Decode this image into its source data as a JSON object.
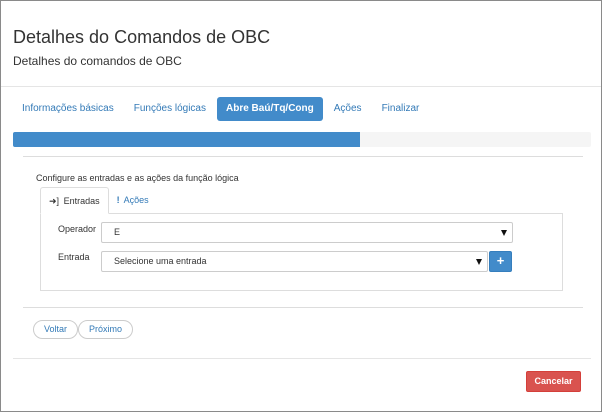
{
  "header": {
    "title": "Detalhes do Comandos de OBC",
    "subtitle": "Detalhes do comandos de OBC"
  },
  "wizard": {
    "steps": [
      {
        "label": "Informações básicas",
        "active": false
      },
      {
        "label": "Funções lógicas",
        "active": false
      },
      {
        "label": "Abre Baú/Tq/Cong",
        "active": true
      },
      {
        "label": "Ações",
        "active": false
      },
      {
        "label": "Finalizar",
        "active": false
      }
    ],
    "progress_fraction": 0.6
  },
  "logic": {
    "description": "Configure as entradas e as ações da função lógica",
    "tabs": [
      {
        "label": "Entradas",
        "icon": "sign-in-icon",
        "active": true
      },
      {
        "label": "Ações",
        "icon": "exclamation-icon",
        "active": false
      }
    ],
    "operator": {
      "label": "Operador",
      "value": "E"
    },
    "input": {
      "label": "Entrada",
      "value": "Selecione uma entrada"
    },
    "add_label": "+"
  },
  "navigation": {
    "back_label": "Voltar",
    "next_label": "Próximo"
  },
  "footer": {
    "cancel_label": "Cancelar"
  },
  "colors": {
    "primary": "#428bca",
    "link": "#337ab7",
    "danger": "#d9534f"
  }
}
